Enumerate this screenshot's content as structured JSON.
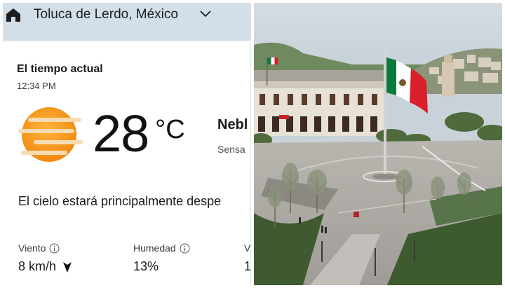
{
  "header": {
    "location": "Toluca de Lerdo, México",
    "home_icon": "home-icon",
    "dropdown_icon": "chevron-down-icon"
  },
  "current": {
    "title": "El tiempo actual",
    "time": "12:34 PM",
    "icon": "hazy-sun-icon",
    "temperature": "28",
    "unit": "°C",
    "condition": "Nebl",
    "condition_sub": "Sensa",
    "forecast": "El cielo estará principalmente despe"
  },
  "metrics": [
    {
      "label": "Viento",
      "value": "8 km/h",
      "icon": "info-icon",
      "direction_icon": "wind-arrow-icon"
    },
    {
      "label": "Humedad",
      "value": "13%",
      "icon": "info-icon"
    },
    {
      "label": "V",
      "value": "1"
    }
  ],
  "photo": {
    "subject": "plaza-with-mexican-flag"
  },
  "colors": {
    "header_bg": "#d2dfe9",
    "sun_orange": "#f39a1c",
    "flag_green": "#0b7a3e",
    "flag_red": "#d81f2a"
  }
}
